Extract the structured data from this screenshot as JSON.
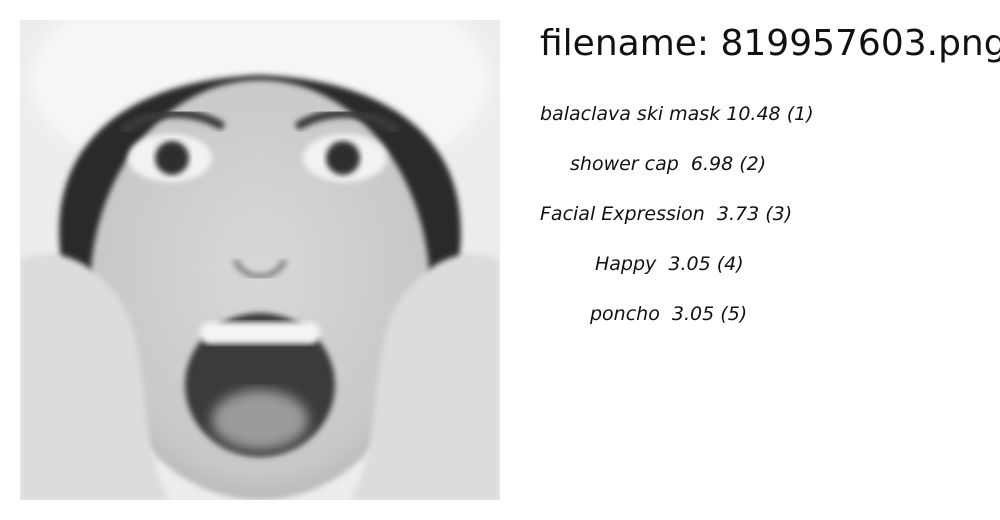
{
  "header": {
    "filename_prefix": "filename: ",
    "filename": "819957603.png"
  },
  "image": {
    "description_icon": "photo-face"
  },
  "labels": [
    {
      "name": "balaclava ski mask",
      "score": "10.48",
      "rank": "(1)"
    },
    {
      "name": "shower cap",
      "score": " 6.98",
      "rank": "(2)"
    },
    {
      "name": "Facial Expression",
      "score": " 3.73",
      "rank": "(3)"
    },
    {
      "name": "Happy",
      "score": " 3.05",
      "rank": "(4)"
    },
    {
      "name": "poncho",
      "score": " 3.05",
      "rank": "(5)"
    }
  ]
}
